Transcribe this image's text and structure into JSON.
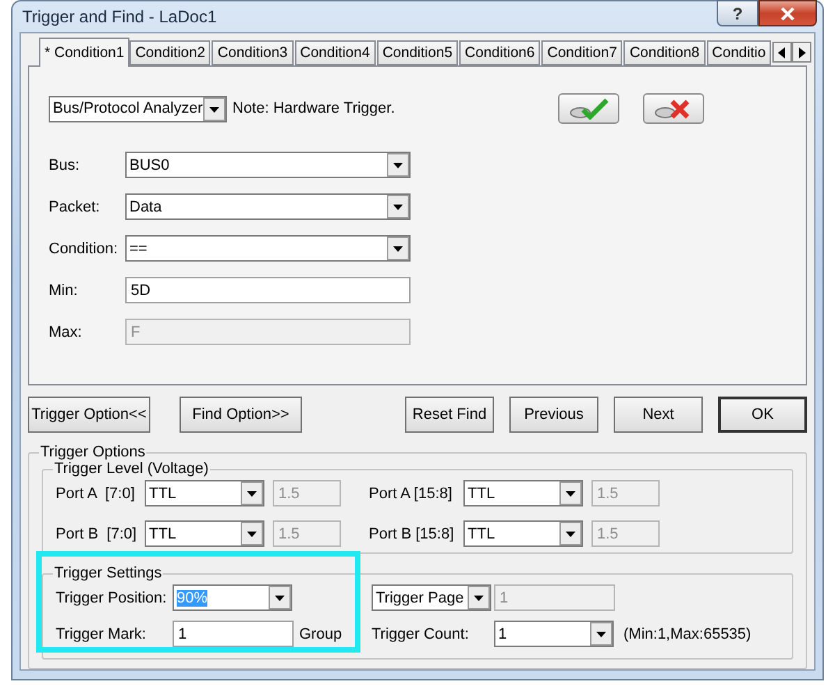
{
  "window": {
    "title": "Trigger and Find - LaDoc1",
    "help": "?"
  },
  "tabs": [
    {
      "label": "* Condition1",
      "selected": true
    },
    {
      "label": "Condition2",
      "selected": false
    },
    {
      "label": "Condition3",
      "selected": false
    },
    {
      "label": "Condition4",
      "selected": false
    },
    {
      "label": "Condition5",
      "selected": false
    },
    {
      "label": "Condition6",
      "selected": false
    },
    {
      "label": "Condition7",
      "selected": false
    },
    {
      "label": "Condition8",
      "selected": false
    },
    {
      "label": "Conditio",
      "selected": false
    }
  ],
  "analyzer": {
    "value": "Bus/Protocol Analyzer",
    "note": "Note: Hardware Trigger."
  },
  "fields": [
    {
      "kind": "combo",
      "label": "Bus:",
      "value": "BUS0"
    },
    {
      "kind": "combo",
      "label": "Packet:",
      "value": "Data"
    },
    {
      "kind": "combo",
      "label": "Condition:",
      "value": "=="
    },
    {
      "kind": "text",
      "label": "Min:",
      "value": "5D",
      "disabled": false
    },
    {
      "kind": "text",
      "label": "Max:",
      "value": "F",
      "disabled": true
    }
  ],
  "left_buttons": [
    {
      "label": "Trigger Option<<",
      "default": false
    },
    {
      "label": "Find Option>>",
      "default": false
    }
  ],
  "right_buttons": [
    {
      "label": "Reset Find",
      "default": false
    },
    {
      "label": "Previous",
      "default": false
    },
    {
      "label": "Next",
      "default": false
    },
    {
      "label": "OK",
      "default": true
    }
  ],
  "trigger_options": {
    "title": "Trigger Options",
    "level": {
      "title": "Trigger Level (Voltage)",
      "ports": [
        {
          "label": "Port A  [7:0]",
          "mode": "TTL",
          "voltage": "1.5"
        },
        {
          "label": "Port A [15:8]",
          "mode": "TTL",
          "voltage": "1.5"
        },
        {
          "label": "Port B  [7:0]",
          "mode": "TTL",
          "voltage": "1.5"
        },
        {
          "label": "Port B [15:8]",
          "mode": "TTL",
          "voltage": "1.5"
        }
      ]
    },
    "settings": {
      "title": "Trigger Settings",
      "highlighted": true,
      "position_label": "Trigger Position:",
      "position_value": "90%",
      "position_value_selected": true,
      "mark_label": "Trigger Mark:",
      "mark_value": "1",
      "mark_unit": "Group",
      "page_mode": "Trigger Page",
      "page_value": "1",
      "count_label": "Trigger Count:",
      "count_value": "1",
      "count_range": "(Min:1,Max:65535)"
    }
  }
}
